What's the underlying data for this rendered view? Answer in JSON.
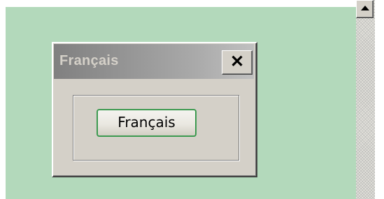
{
  "dialog": {
    "title": "Français",
    "close_label": "✕"
  },
  "language_button": {
    "label": "Français"
  },
  "scrollbar": {
    "up_arrow_icon": "triangle-up"
  },
  "colors": {
    "background": "#b3d9bb",
    "accent_border": "#3c9a50"
  }
}
